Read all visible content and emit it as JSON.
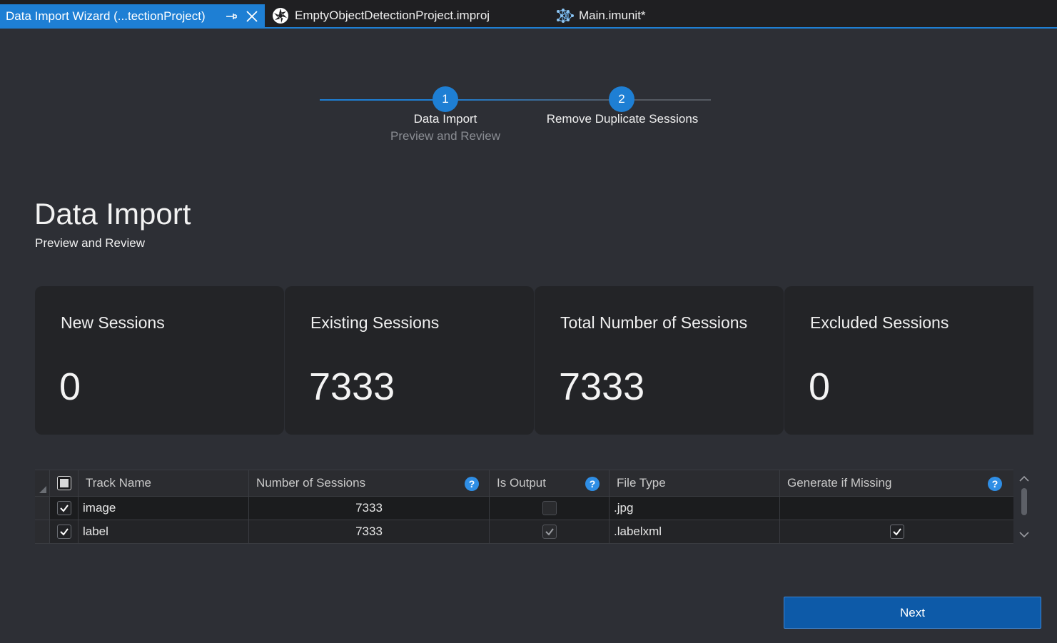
{
  "tabs": [
    {
      "label": "Data Import Wizard (...tectionProject)",
      "active": true,
      "icons": [
        "pin-icon",
        "close-icon"
      ]
    },
    {
      "label": "EmptyObjectDetectionProject.improj",
      "active": false,
      "icon": "project-icon"
    },
    {
      "label": "Main.imunit*",
      "active": false,
      "icon": "network-icon"
    }
  ],
  "stepper": {
    "steps": [
      {
        "number": "1",
        "title": "Data Import",
        "subtitle": "Preview and Review"
      },
      {
        "number": "2",
        "title": "Remove Duplicate Sessions"
      }
    ]
  },
  "header": {
    "title": "Data Import",
    "subtitle": "Preview and Review"
  },
  "cards": [
    {
      "label": "New Sessions",
      "value": "0"
    },
    {
      "label": "Existing Sessions",
      "value": "7333"
    },
    {
      "label": "Total Number of Sessions",
      "value": "7333"
    },
    {
      "label": "Excluded Sessions",
      "value": "0"
    }
  ],
  "grid": {
    "columns": [
      "Track Name",
      "Number of Sessions",
      "Is Output",
      "File Type",
      "Generate if Missing"
    ],
    "rows": [
      {
        "selected": true,
        "track_name": "image",
        "sessions": "7333",
        "is_output": false,
        "file_type": ".jpg",
        "generate_if_missing": null
      },
      {
        "selected": true,
        "track_name": "label",
        "sessions": "7333",
        "is_output": true,
        "file_type": ".labelxml",
        "generate_if_missing": true
      }
    ]
  },
  "actions": {
    "next_label": "Next"
  },
  "colors": {
    "accent": "#1e7fd4",
    "background": "#2d2f35",
    "card": "#232427",
    "button": "#0d5aa8"
  }
}
